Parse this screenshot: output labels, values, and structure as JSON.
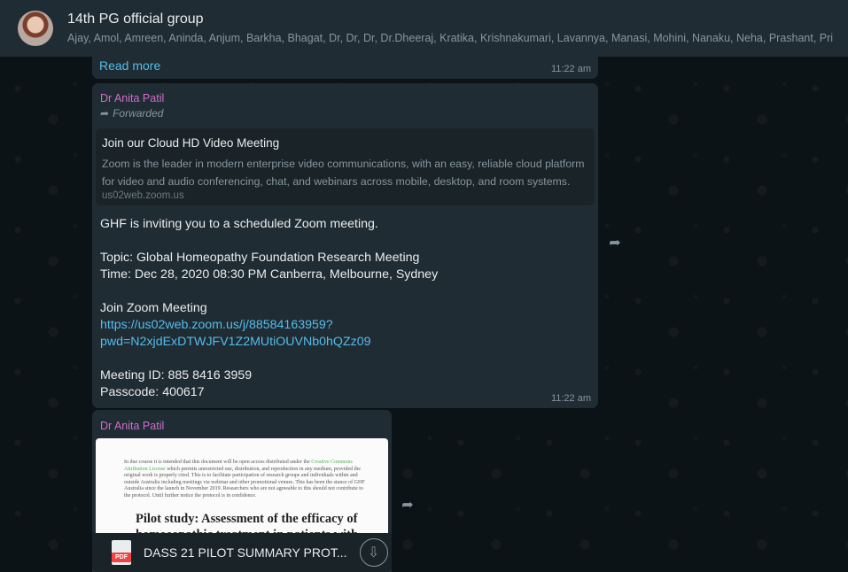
{
  "header": {
    "group_name": "14th PG official group",
    "participants": "Ajay, Amol, Amreen, Aninda, Anjum, Barkha, Bhagat, Dr, Dr, Dr, Dr.Dheeraj, Kratika, Krishnakumari, Lavannya, Manasi, Mohini, Nanaku, Neha, Prashant, Pri"
  },
  "messages": [
    {
      "read_more": "Read more",
      "time": "11:22 am"
    },
    {
      "sender": "Dr Anita Patil",
      "forwarded_label": "Forwarded",
      "preview": {
        "title": "Join our Cloud HD Video Meeting",
        "description": "Zoom is the leader in modern enterprise video communications, with an easy, reliable cloud platform for video and audio conferencing, chat, and webinars across mobile, desktop, and room systems.",
        "domain": "us02web.zoom.us"
      },
      "line1": "GHF is inviting you to a scheduled Zoom meeting.",
      "topic": "Topic: Global Homeopathy Foundation Research Meeting",
      "meeting_time": "Time: Dec 28, 2020 08:30 PM Canberra, Melbourne, Sydney",
      "join_label": "Join Zoom Meeting",
      "link_line1": "https://us02web.zoom.us/j/88584163959?",
      "link_line2": "pwd=N2xjdExDTWJFV1Z2MUtiOUVNb0hQZz09",
      "meeting_id": "Meeting ID: 885 8416 3959",
      "passcode": "Passcode: 400617",
      "time": "11:22 am"
    },
    {
      "sender": "Dr Anita Patil",
      "doc_preview_text_a": "In due course it is intended that this document will be open access distributed under the ",
      "doc_preview_link": "Creative Commons Attribution License",
      "doc_preview_text_b": " which permits unrestricted use, distribution, and reproduction in any medium, provided the original work is properly cited. This is to facilitate participation of research groups and individuals within and outside Australia including meetings via webinar and other promotional venues. This has been the stance of GHF Australia since the launch in November 2019. Researchers who are not agreeable to this should not contribute to the protocol. Until further notice the protocol is in confidence.",
      "doc_heading": "Pilot study: Assessment of the efficacy of homoeopathic treatment in patients with",
      "pdf_label": "PDF",
      "file_name": "DASS 21 PILOT SUMMARY PROT..."
    }
  ],
  "icons": {
    "forward": "forward-icon",
    "download": "download-icon",
    "pdf": "pdf-file-icon"
  },
  "colors": {
    "header_bg": "#202c33",
    "bubble_bg": "#202c33",
    "sender_name": "#d06ec9",
    "link": "#53bdeb",
    "chat_bg": "#0c1317"
  }
}
